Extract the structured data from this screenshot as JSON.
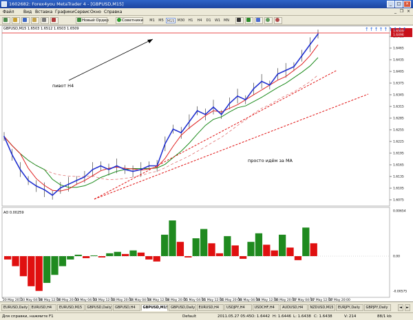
{
  "window": {
    "title": "1602682: Forex4you MetaTrader 4 - [GBPUSD,M15]",
    "minimize": "_",
    "maximize": "□",
    "close": "×"
  },
  "menu": {
    "items": [
      "Файл",
      "Вид",
      "Вставка",
      "Графики",
      "Сервис",
      "Окно",
      "Справка"
    ],
    "child_minimize": "_",
    "child_restore": "❐",
    "child_close": "×"
  },
  "toolbar": {
    "new_order": "Новый Ордер",
    "experts": "Советники",
    "timeframes": [
      "M1",
      "M5",
      "M15",
      "M30",
      "H1",
      "H4",
      "D1",
      "W1",
      "MN"
    ],
    "active_timeframe": "M15"
  },
  "chart": {
    "symbol_info": "GBPUSD,M15 1.6503 1.6512 1.6503 1.6509",
    "indicator_info": "AO 0.00259",
    "buy_arrows": "↑↑↑↑↑↑↑↑↑",
    "annotation_h4": "пивот H4",
    "annotation_ma": "просто идём за МА",
    "colors": {
      "price": "#1f2fd0",
      "wick": "#222222",
      "ma_fast": "#e02020",
      "ma_slow": "#1b8a1b",
      "ma_dashed": "#e07070",
      "trend": "#e01010",
      "ao_up": "#1f8a1f",
      "ao_down": "#e01010"
    }
  },
  "chart_data": {
    "type": "line",
    "y_ticks": [
      "1.6480",
      "1.6465",
      "1.6435",
      "1.6405",
      "1.6375",
      "1.6345",
      "1.6315",
      "1.6285",
      "1.6255",
      "1.6225",
      "1.6195",
      "1.6165",
      "1.6135",
      "1.6105",
      "1.6075"
    ],
    "current_price": "1.6509",
    "current_price_secondary": "1.6496",
    "x_ticks": [
      "20 May 2011",
      "20 May 04:00",
      "20 May 12:00",
      "20 May 20:00",
      "23 May 04:00",
      "23 May 12:00",
      "23 May 20:00",
      "24 May 04:00",
      "24 May 12:00",
      "24 May 20:00",
      "25 May 04:00",
      "25 May 12:00",
      "25 May 20:00",
      "26 May 04:00",
      "26 May 12:00",
      "26 May 20:00",
      "27 May 04:00",
      "27 May 12:00",
      "27 May 20:00"
    ],
    "ylim": [
      1.605,
      1.651
    ],
    "close_series": {
      "name": "GBPUSD,M15",
      "x": [
        0,
        4,
        8,
        12,
        16,
        20,
        24,
        28,
        32,
        36,
        40,
        44,
        48,
        52,
        56,
        60,
        64,
        68,
        72,
        76,
        80,
        84,
        88,
        92,
        96,
        100,
        104,
        108,
        112,
        116,
        120,
        124,
        128,
        132,
        136,
        140,
        144,
        148,
        152,
        156
      ],
      "values": [
        1.623,
        1.618,
        1.614,
        1.611,
        1.6095,
        1.6085,
        1.607,
        1.609,
        1.61,
        1.611,
        1.612,
        1.614,
        1.615,
        1.614,
        1.615,
        1.614,
        1.6135,
        1.614,
        1.615,
        1.615,
        1.621,
        1.625,
        1.624,
        1.627,
        1.63,
        1.629,
        1.631,
        1.629,
        1.632,
        1.634,
        1.633,
        1.636,
        1.638,
        1.637,
        1.64,
        1.641,
        1.642,
        1.645,
        1.648,
        1.6509
      ]
    },
    "ao": {
      "ylim": [
        -0.00575,
        0.00654
      ],
      "y_ticks": [
        "0.00654",
        "0.00",
        "-0.00575"
      ],
      "values": [
        -0.0005,
        -0.0015,
        -0.003,
        -0.0045,
        -0.0052,
        -0.004,
        -0.0028,
        -0.0015,
        -0.0005,
        0.0002,
        -0.0003,
        0.0001,
        -0.0002,
        0.0004,
        0.0006,
        0.0003,
        0.0008,
        0.0005,
        -0.0005,
        -0.0008,
        0.003,
        0.005,
        0.002,
        -0.0002,
        0.0025,
        0.0038,
        0.0018,
        0.0004,
        0.0028,
        0.0015,
        -0.0004,
        0.002,
        0.0032,
        0.0016,
        0.0008,
        0.003,
        0.0012,
        -0.0006,
        0.004,
        0.0018
      ]
    }
  },
  "tabs": {
    "items": [
      "EURUSD,Daily",
      "EURUSD,H4",
      "EURUSD,M15",
      "GBPUSD,Daily",
      "GBPUSD,H4",
      "GBPUSD,M15",
      "GBPUSD,Daily",
      "EURUSD,H4",
      "USDJPY,H4",
      "USDCHF,H4",
      "AUDUSD,H4",
      "NZDUSD,M15",
      "EURJPY,Daily",
      "GBPJPY,Daily"
    ],
    "active_index": 5
  },
  "status": {
    "help": "Для справки, нажмите F1",
    "profile": "Default",
    "datetime": "2011.05.27 05:45",
    "open": "O: 1.6442",
    "high": "H: 1.6446",
    "low": "L: 1.6438",
    "close": "C: 1.6438",
    "volume": "V: 214",
    "traffic": "88/1 kb"
  }
}
